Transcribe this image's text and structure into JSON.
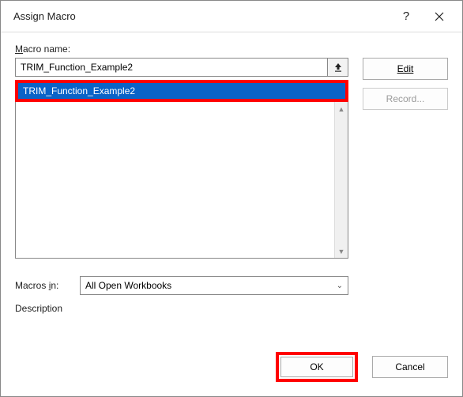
{
  "dialog": {
    "title": "Assign Macro"
  },
  "labels": {
    "macro_name_prefix": "M",
    "macro_name_rest": "acro name:",
    "macros_in_prefix": "Macros ",
    "macros_in_ul": "i",
    "macros_in_rest": "n:",
    "description": "Description"
  },
  "fields": {
    "macro_name_value": "TRIM_Function_Example2"
  },
  "list": {
    "selected": "TRIM_Function_Example2"
  },
  "combo": {
    "macros_in_selected": "All Open Workbooks"
  },
  "buttons": {
    "edit": "Edit",
    "record": "Record...",
    "ok": "OK",
    "cancel": "Cancel"
  }
}
